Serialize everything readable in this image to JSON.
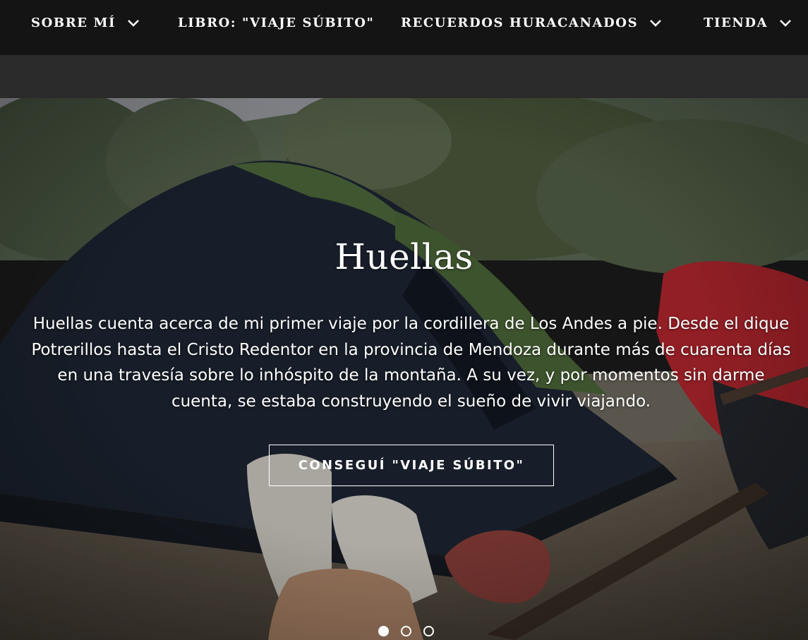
{
  "nav": {
    "items": [
      {
        "label": "SOBRE MÍ",
        "has_dropdown": true
      },
      {
        "label": "LIBRO: \"VIAJE SÚBITO\"",
        "has_dropdown": false
      },
      {
        "label": "RECUERDOS HURACANADOS",
        "has_dropdown": true
      },
      {
        "label": "TIENDA",
        "has_dropdown": true
      }
    ]
  },
  "hero": {
    "title": "Huellas",
    "text": "Huellas cuenta acerca de mi primer viaje por la cordillera de Los Andes a pie. Desde el dique Potrerillos hasta el Cristo Redentor en la provincia de Mendoza durante más de cuarenta días en una travesía sobre lo inhóspito de la montaña. A su vez, y por momentos sin darme cuenta, se estaba construyendo el sueño de vivir viajando.",
    "cta_label": "CONSEGUÍ \"VIAJE SÚBITO\"",
    "slides_total": 3,
    "active_slide": 1
  },
  "colors": {
    "nav_bg": "#141414",
    "subbar_bg": "#2a2a2a",
    "text": "#ffffff"
  }
}
